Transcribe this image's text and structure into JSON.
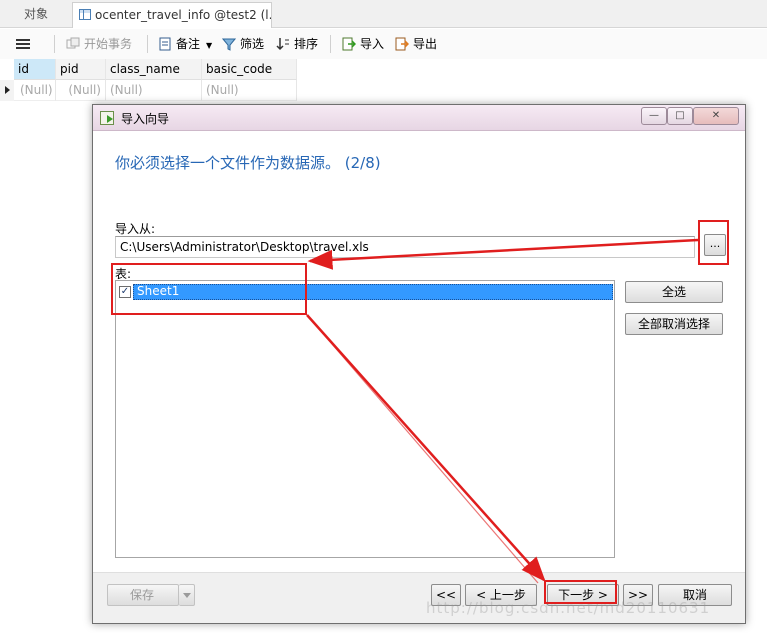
{
  "tabs": [
    {
      "label": "对象"
    },
    {
      "label": "ocenter_travel_info @test2 (l..."
    }
  ],
  "toolbar": {
    "begin_transaction": "开始事务",
    "memo": "备注",
    "filter": "筛选",
    "sort": "排序",
    "import": "导入",
    "export": "导出"
  },
  "grid": {
    "columns": [
      "id",
      "pid",
      "class_name",
      "basic_code"
    ],
    "rows": [
      [
        "(Null)",
        "(Null)",
        "(Null)",
        "(Null)"
      ]
    ]
  },
  "dialog": {
    "title": "导入向导",
    "heading": "你必须选择一个文件作为数据源。 (2/8)",
    "import_from_label": "导入从:",
    "file_path": "C:\\Users\\Administrator\\Desktop\\travel.xls",
    "browse_label": "...",
    "table_label": "表:",
    "tables": [
      {
        "name": "Sheet1",
        "checked": true
      }
    ],
    "select_all": "全选",
    "deselect_all": "全部取消选择",
    "footer": {
      "save": "保存",
      "first": "<<",
      "prev": "< 上一步",
      "next": "下一步 >",
      "last": ">>",
      "cancel": "取消"
    }
  },
  "watermark": "http://blog.csdn.net/md20110631",
  "colors": {
    "annotation": "#e01e1e",
    "heading": "#2767b5",
    "selection": "#3399ff"
  }
}
